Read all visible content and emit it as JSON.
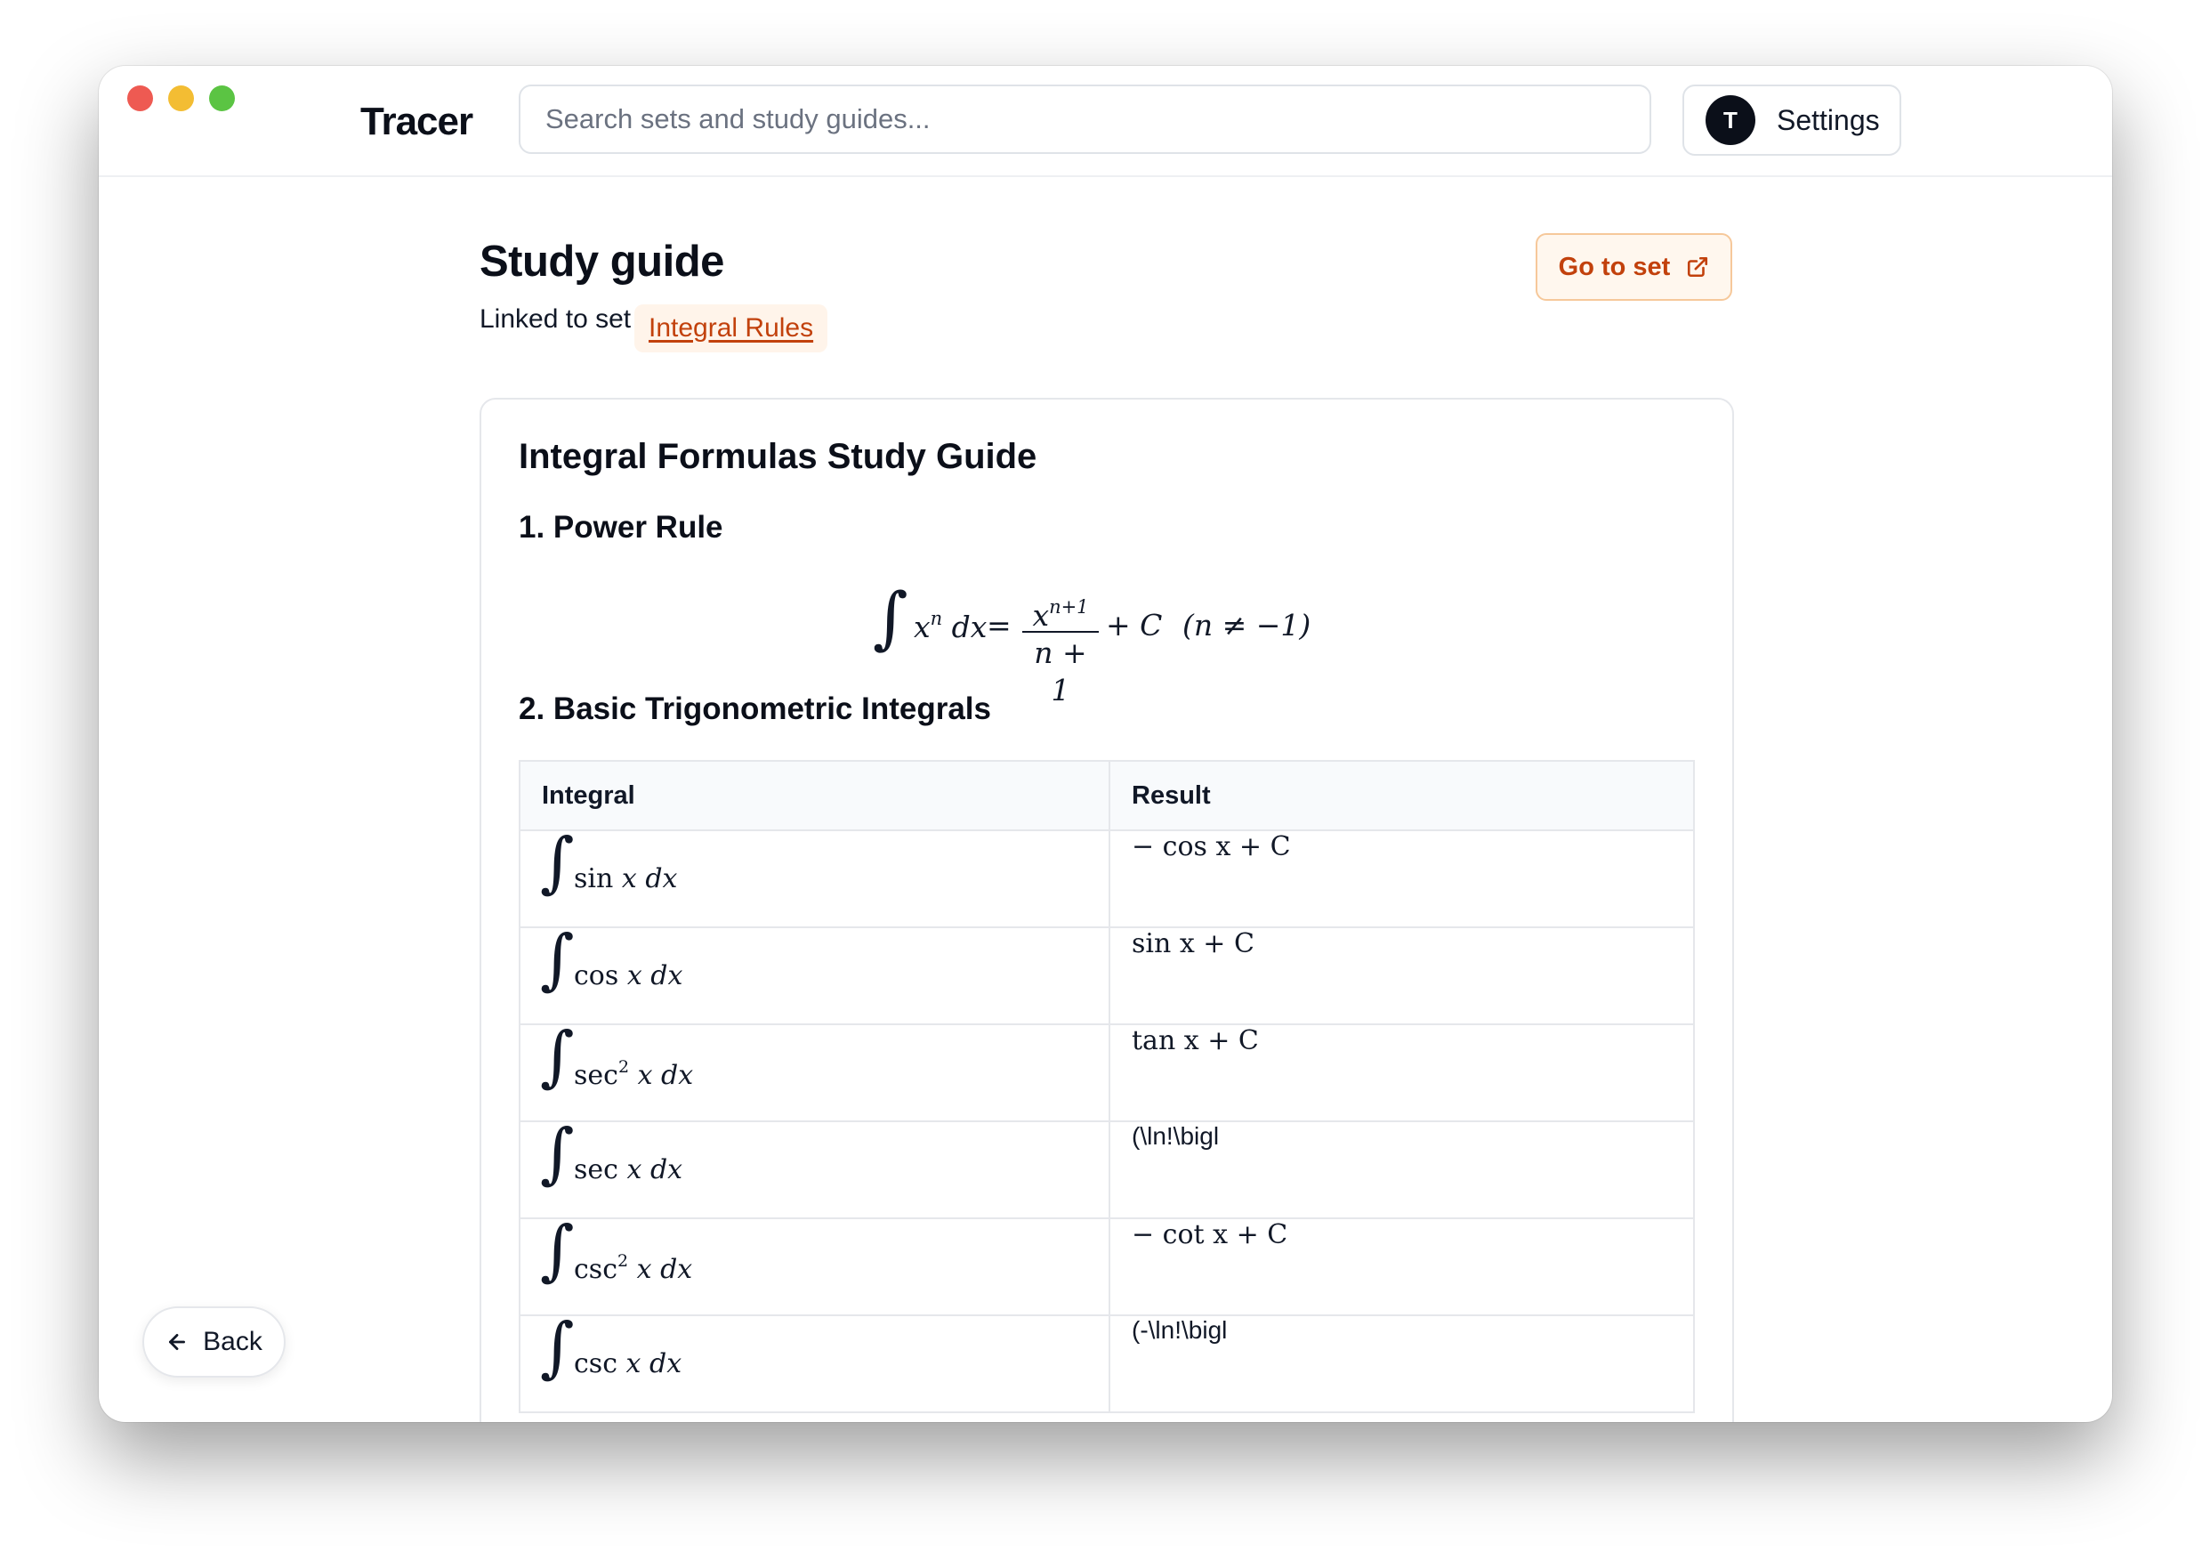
{
  "app": {
    "brand": "Tracer"
  },
  "search": {
    "placeholder": "Search sets and study guides..."
  },
  "settings": {
    "avatar_letter": "T",
    "label": "Settings"
  },
  "page": {
    "title": "Study guide",
    "linked_prefix": "Linked to set",
    "linked_set": "Integral Rules",
    "go_to_set": "Go to set"
  },
  "guide": {
    "title": "Integral Formulas Study Guide",
    "section1": "1. Power Rule",
    "section2": "2. Basic Trigonometric Integrals",
    "power_rule": {
      "integral_sign": "∫",
      "lhs_base": "x",
      "lhs_exp": "n",
      "lhs_dx": "dx",
      "equals": "=",
      "numerator_base": "x",
      "numerator_exp": "n+1",
      "denominator": "n + 1",
      "plus_c": "+ C",
      "condition": "(n ≠ −1)"
    },
    "table": {
      "headers": [
        "Integral",
        "Result"
      ],
      "rows": [
        {
          "fn": "sin",
          "power": "",
          "var": "x dx",
          "result": "− cos x + C",
          "raw": false
        },
        {
          "fn": "cos",
          "power": "",
          "var": "x dx",
          "result": "sin x + C",
          "raw": false
        },
        {
          "fn": "sec",
          "power": "2",
          "var": "x dx",
          "result": "tan x + C",
          "raw": false
        },
        {
          "fn": "sec",
          "power": "",
          "var": "x dx",
          "result": "(\\ln!\\bigl",
          "raw": true
        },
        {
          "fn": "csc",
          "power": "2",
          "var": "x dx",
          "result": "− cot x + C",
          "raw": false
        },
        {
          "fn": "csc",
          "power": "",
          "var": "x dx",
          "result": "(-\\ln!\\bigl",
          "raw": true
        }
      ]
    }
  },
  "nav": {
    "back": "Back"
  },
  "colors": {
    "accent": "#c2410c",
    "accent_bg": "#fff7ee",
    "text": "#111827",
    "border": "#e5e7eb"
  }
}
